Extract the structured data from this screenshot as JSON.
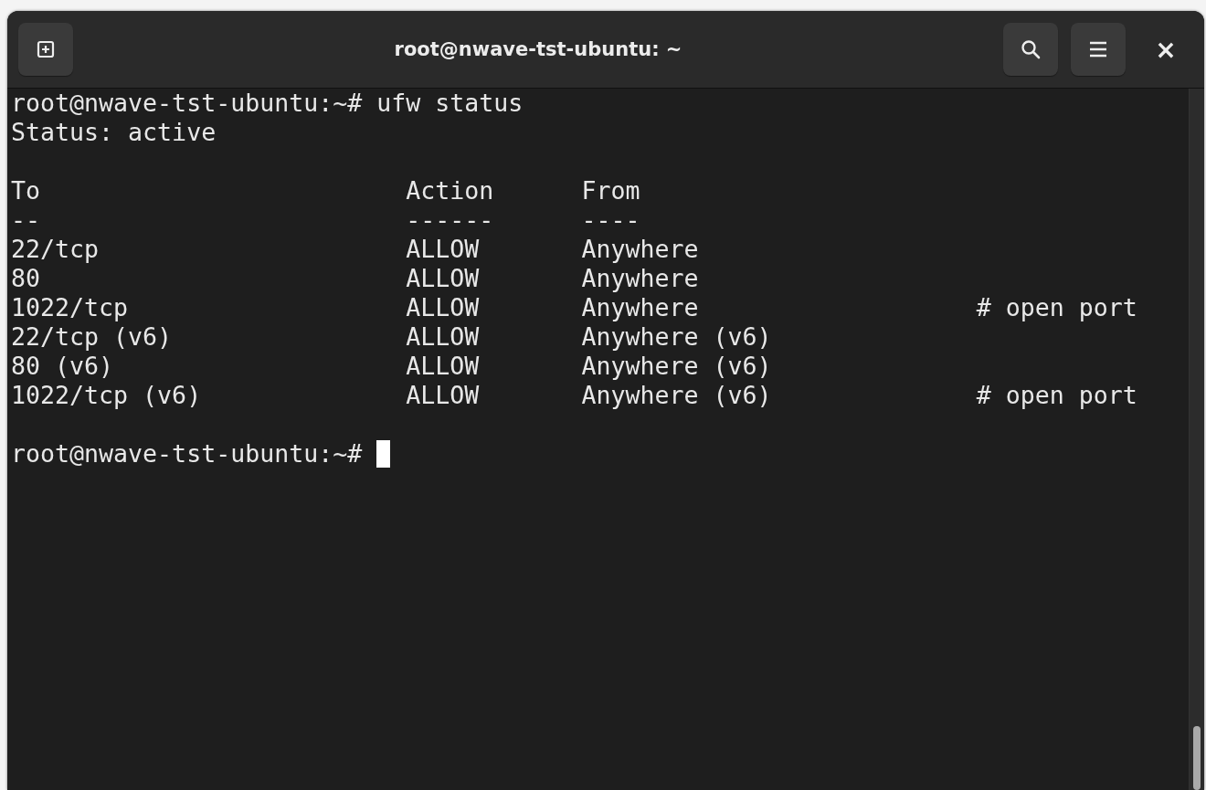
{
  "window": {
    "title": "root@nwave-tst-ubuntu: ~",
    "close_glyph": "×"
  },
  "terminal": {
    "command_line": "root@nwave-tst-ubuntu:~# ufw status",
    "status_line": "Status: active",
    "table": {
      "columns": [
        "To",
        "Action",
        "From"
      ],
      "separators": [
        "--",
        "------",
        "----"
      ],
      "rows": [
        {
          "to": "22/tcp",
          "action": "ALLOW",
          "from": "Anywhere"
        },
        {
          "to": "80",
          "action": "ALLOW",
          "from": "Anywhere"
        },
        {
          "to": "1022/tcp",
          "action": "ALLOW",
          "from": "Anywhere",
          "comment": "# open port"
        },
        {
          "to": "22/tcp (v6)",
          "action": "ALLOW",
          "from": "Anywhere (v6)"
        },
        {
          "to": "80 (v6)",
          "action": "ALLOW",
          "from": "Anywhere (v6)"
        },
        {
          "to": "1022/tcp (v6)",
          "action": "ALLOW",
          "from": "Anywhere (v6)",
          "comment": "# open port"
        }
      ]
    },
    "prompt": "root@nwave-tst-ubuntu:~#"
  }
}
